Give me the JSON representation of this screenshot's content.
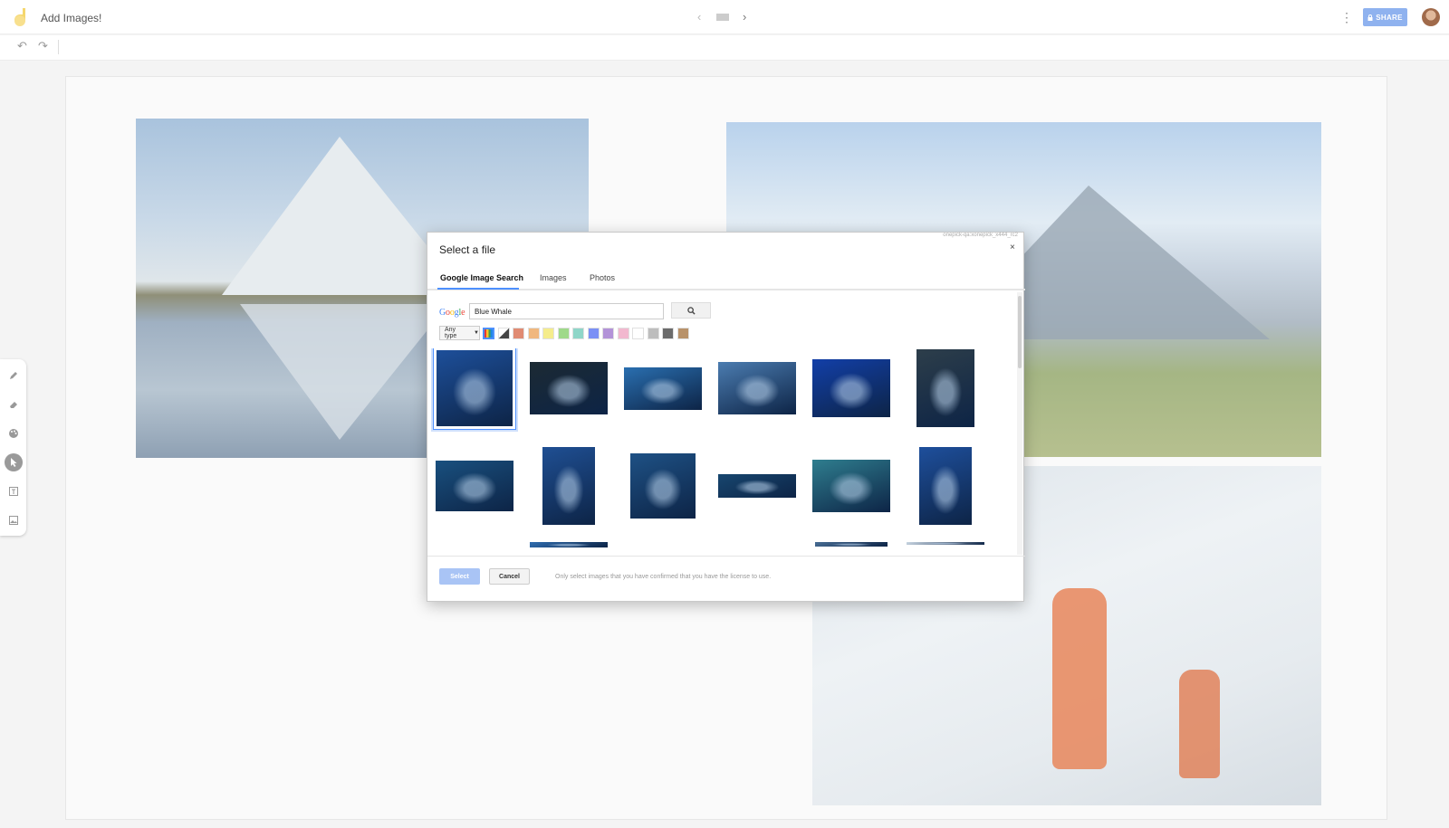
{
  "app": {
    "title": "Add Images!",
    "share_label": "SHARE",
    "colors": {
      "share_bg": "#8fb2ef",
      "accent": "#4d90fe",
      "logo": "#f5d76e"
    }
  },
  "pager": {
    "prev_icon": "chevron-left-icon",
    "next_icon": "chevron-right-icon"
  },
  "toolbar": {
    "undo_icon": "undo-icon",
    "redo_icon": "redo-icon"
  },
  "side_tools": [
    "pen-icon",
    "eraser-icon",
    "palette-icon",
    "cursor-icon",
    "text-box-icon",
    "image-icon"
  ],
  "dialog": {
    "build_label": "onepick-qa:xonepick_x444_rc2",
    "title": "Select a file",
    "close_label": "×",
    "tabs": [
      "Google Image Search",
      "Images",
      "Photos"
    ],
    "active_tab": 0,
    "search": {
      "logo_letters": [
        "G",
        "o",
        "o",
        "g",
        "l",
        "e"
      ],
      "logo_colors": [
        "#4285f4",
        "#ea4335",
        "#fbbc05",
        "#4285f4",
        "#34a853",
        "#ea4335"
      ],
      "query": "Blue Whale",
      "search_icon": "search-icon"
    },
    "filters": {
      "type_label": "Any type",
      "swatch_colors": [
        "multicolor",
        "black-white",
        "#e08b73",
        "#f0b77e",
        "#f5ec8c",
        "#9fd98a",
        "#8fd6c8",
        "#7b90f5",
        "#b393d8",
        "#f2b8cf",
        "#ffffff",
        "#bdbdbd",
        "#6b6b6b",
        "#b8926a"
      ],
      "selected_swatch": 0
    },
    "results": [
      [
        {
          "w": 84,
          "h": 84,
          "bg": "#1d4f9a"
        },
        {
          "w": 86,
          "h": 58,
          "bg": "#1c2a33"
        },
        {
          "w": 86,
          "h": 47,
          "bg": "#2a6fb0"
        },
        {
          "w": 86,
          "h": 58,
          "bg": "#4b7cb0"
        },
        {
          "w": 86,
          "h": 64,
          "bg": "#123fa8"
        },
        {
          "w": 64,
          "h": 86,
          "bg": "#2d3e4a"
        }
      ],
      [
        {
          "w": 86,
          "h": 56,
          "bg": "#19507f"
        },
        {
          "w": 58,
          "h": 86,
          "bg": "#1f4f93"
        },
        {
          "w": 72,
          "h": 72,
          "bg": "#1e5185"
        },
        {
          "w": 86,
          "h": 26,
          "bg": "#17466f"
        },
        {
          "w": 86,
          "h": 58,
          "bg": "#2f7e8f"
        },
        {
          "w": 58,
          "h": 86,
          "bg": "#1e4f9c"
        }
      ],
      [
        {
          "w": 0,
          "h": 0,
          "bg": "#ffffff"
        },
        {
          "w": 86,
          "h": 6,
          "bg": "#2f6db0"
        },
        {
          "w": 0,
          "h": 0,
          "bg": "#ffffff"
        },
        {
          "w": 0,
          "h": 0,
          "bg": "#ffffff"
        },
        {
          "w": 80,
          "h": 5,
          "bg": "#486d94"
        },
        {
          "w": 86,
          "h": 3,
          "bg": "#cbd8e4"
        }
      ]
    ],
    "selected_result": 0,
    "select_label": "Select",
    "cancel_label": "Cancel",
    "license_note": "Only select images that you have confirmed that you have the license to use."
  }
}
